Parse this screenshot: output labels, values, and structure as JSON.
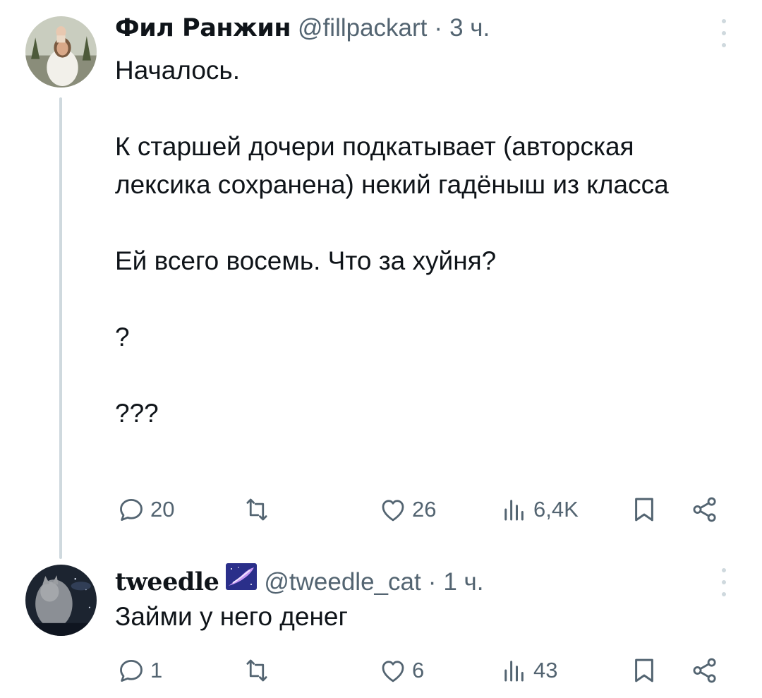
{
  "accent_color": "#1d9bf0",
  "text_color": "#0f1419",
  "muted_color": "#536471",
  "tweets": [
    {
      "author_name": "Фил Ранжин",
      "handle": "@fillpackart",
      "separator": "·",
      "time": "3 ч.",
      "text": "Началось.\n\nК старшей дочери подкатывает (авторская лексика сохранена) некий гадёныш из класса\n\nЕй всего восемь. Что за хуйня?\n\n?\n\n???",
      "replies": "20",
      "retweets": "",
      "likes": "26",
      "views": "6,4K"
    },
    {
      "author_name": "tweedle",
      "badge_icon": "galaxy-emoji-icon",
      "handle": "@tweedle_cat",
      "separator": "·",
      "time": "1 ч.",
      "text": "Займи у него денег",
      "replies": "1",
      "retweets": "",
      "likes": "6",
      "views": "43"
    }
  ]
}
